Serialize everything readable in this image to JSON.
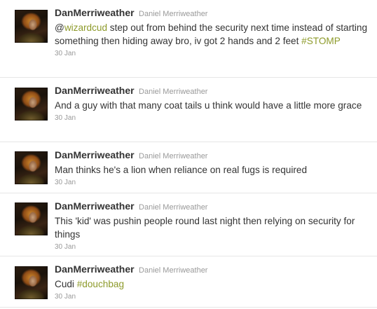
{
  "tweets": [
    {
      "screen_name": "DanMerriweather",
      "full_name": "Daniel Merriweather",
      "text_parts": [
        {
          "type": "text",
          "value": "@"
        },
        {
          "type": "mention",
          "value": "wizardcud"
        },
        {
          "type": "text",
          "value": " step out from behind the security next time instead of starting something then hiding away bro, iv got 2 hands and 2 feet "
        },
        {
          "type": "hashtag",
          "value": "#STOMP"
        }
      ],
      "time": "30 Jan"
    },
    {
      "screen_name": "DanMerriweather",
      "full_name": "Daniel Merriweather",
      "text_parts": [
        {
          "type": "text",
          "value": "And a guy with that many coat tails u think would have a little more grace"
        }
      ],
      "time": "30 Jan"
    },
    {
      "screen_name": "DanMerriweather",
      "full_name": "Daniel Merriweather",
      "text_parts": [
        {
          "type": "text",
          "value": "Man thinks he's a lion when reliance on real fugs is required"
        }
      ],
      "time": "30 Jan"
    },
    {
      "screen_name": "DanMerriweather",
      "full_name": "Daniel Merriweather",
      "text_parts": [
        {
          "type": "text",
          "value": "This 'kid' was pushin people round last night then relying on security for things"
        }
      ],
      "time": "30 Jan"
    },
    {
      "screen_name": "DanMerriweather",
      "full_name": "Daniel Merriweather",
      "text_parts": [
        {
          "type": "text",
          "value": "Cudi "
        },
        {
          "type": "hashtag",
          "value": "#douchbag"
        }
      ],
      "time": "30 Jan"
    }
  ],
  "colors": {
    "link": "#8d9a2a",
    "text": "#333333",
    "meta": "#999999"
  },
  "icons": {
    "avatar": "profile-photo"
  }
}
